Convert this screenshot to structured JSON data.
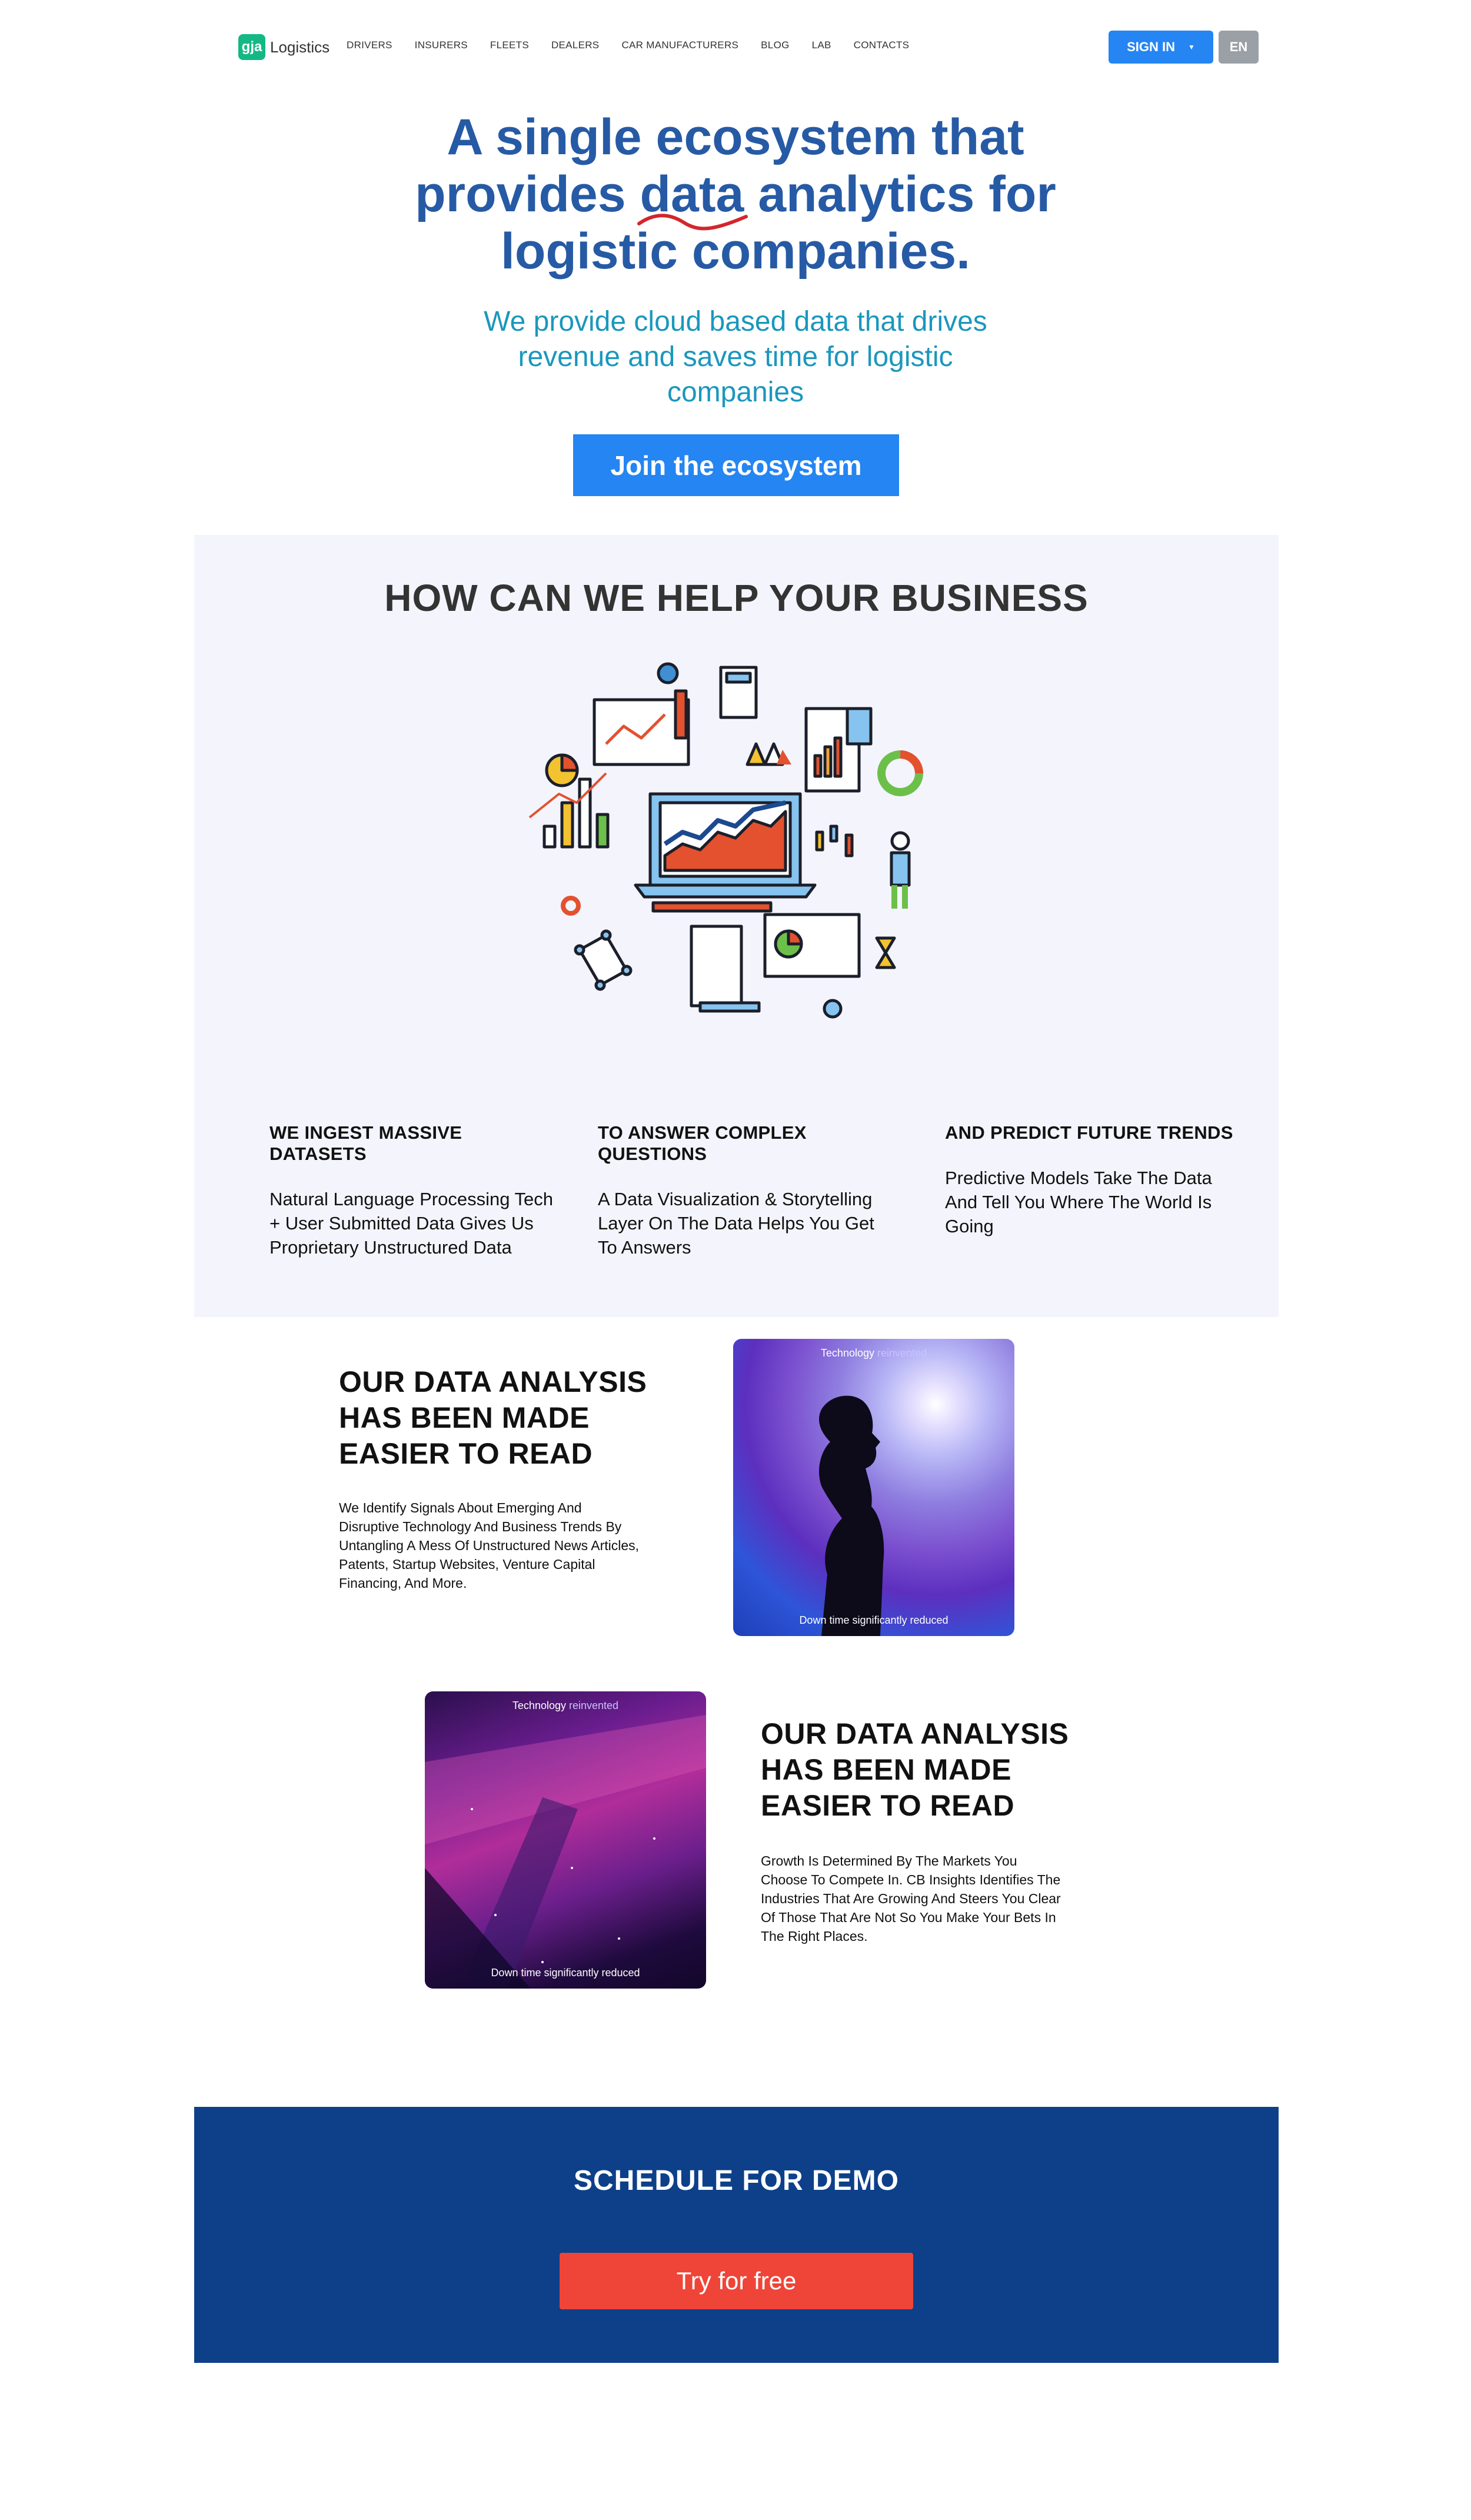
{
  "nav": {
    "logo_mark": "gja",
    "logo_text": "Logistics",
    "items": [
      "DRIVERS",
      "INSURERS",
      "FLEETS",
      "DEALERS",
      "CAR MANUFACTURERS",
      "BLOG",
      "LAB",
      "CONTACTS"
    ],
    "signin_label": "SIGN IN",
    "lang_label": "EN"
  },
  "hero": {
    "title_line1": "A single ecosystem that",
    "title_line2_a": "provides ",
    "title_line2_b": "data",
    "title_line2_c": " analytics for",
    "title_line3": "logistic companies.",
    "subtitle": "We provide cloud based data that drives revenue and saves time for logistic companies",
    "cta_label": "Join the ecosystem"
  },
  "help": {
    "title": "HOW CAN WE HELP YOUR BUSINESS",
    "columns": [
      {
        "heading": "WE INGEST MASSIVE DATASETS",
        "text": "Natural Language Processing Tech + User Submitted Data Gives Us Proprietary Unstructured Data"
      },
      {
        "heading": "TO ANSWER COMPLEX QUESTIONS",
        "text": "A Data Visualization & Storytelling Layer On The Data Helps You Get To Answers"
      },
      {
        "heading": "AND PREDICT FUTURE TRENDS",
        "text": "Predictive Models Take The Data And Tell You Where The World Is Going"
      }
    ]
  },
  "feature1": {
    "title": "OUR DATA ANALYSIS HAS BEEN MADE EASIER TO READ",
    "text": "We Identify Signals About Emerging And Disruptive Technology And Business Trends By Untangling A Mess Of Unstructured News Articles, Patents, Startup Websites, Venture Capital Financing, And More.",
    "card_top_a": "Technology",
    "card_top_b": " reinvented",
    "card_bottom": "Down time significantly reduced"
  },
  "feature2": {
    "title": "OUR DATA ANALYSIS HAS BEEN MADE EASIER TO READ",
    "text": "Growth Is Determined By The Markets You Choose To Compete In. CB Insights Identifies The Industries That Are Growing And Steers You Clear Of Those That Are Not So You Make Your Bets In The Right Places.",
    "card_top_a": "Technology",
    "card_top_b": " reinvented",
    "card_bottom": "Down time significantly reduced"
  },
  "demo": {
    "title": "SCHEDULE FOR DEMO",
    "cta_label": "Try for free"
  },
  "colors": {
    "primary_blue": "#2585f2",
    "title_blue": "#265aa5",
    "subtitle_teal": "#1b97bd",
    "demo_bg": "#0d4089",
    "cta_red": "#ef4438",
    "logo_green": "#14b884"
  }
}
